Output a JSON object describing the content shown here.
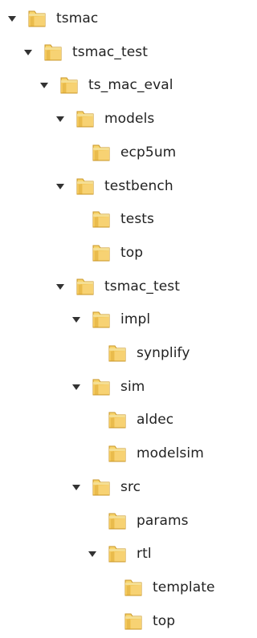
{
  "tree": {
    "nodes": [
      {
        "label": "tsmac",
        "expanded": true,
        "level": 0
      },
      {
        "label": "tsmac_test",
        "expanded": true,
        "level": 1
      },
      {
        "label": "ts_mac_eval",
        "expanded": true,
        "level": 2
      },
      {
        "label": "models",
        "expanded": true,
        "level": 3
      },
      {
        "label": "ecp5um",
        "expanded": false,
        "level": 4
      },
      {
        "label": "testbench",
        "expanded": true,
        "level": 3
      },
      {
        "label": "tests",
        "expanded": false,
        "level": 4
      },
      {
        "label": "top",
        "expanded": false,
        "level": 4
      },
      {
        "label": "tsmac_test",
        "expanded": true,
        "level": 3
      },
      {
        "label": "impl",
        "expanded": true,
        "level": 4
      },
      {
        "label": "synplify",
        "expanded": false,
        "level": 5
      },
      {
        "label": "sim",
        "expanded": true,
        "level": 4
      },
      {
        "label": "aldec",
        "expanded": false,
        "level": 5
      },
      {
        "label": "modelsim",
        "expanded": false,
        "level": 5
      },
      {
        "label": "src",
        "expanded": true,
        "level": 4
      },
      {
        "label": "params",
        "expanded": false,
        "level": 5
      },
      {
        "label": "rtl",
        "expanded": true,
        "level": 5
      },
      {
        "label": "template",
        "expanded": false,
        "level": 6
      },
      {
        "label": "top",
        "expanded": false,
        "level": 6
      }
    ]
  },
  "icons": {
    "expanded": "expanded-arrow-icon",
    "folder": "folder-icon"
  },
  "colors": {
    "text": "#222222",
    "folder_light": "#F8D56D",
    "folder_mid": "#E7B94B",
    "folder_dark": "#C99526",
    "arrow": "#333333"
  }
}
